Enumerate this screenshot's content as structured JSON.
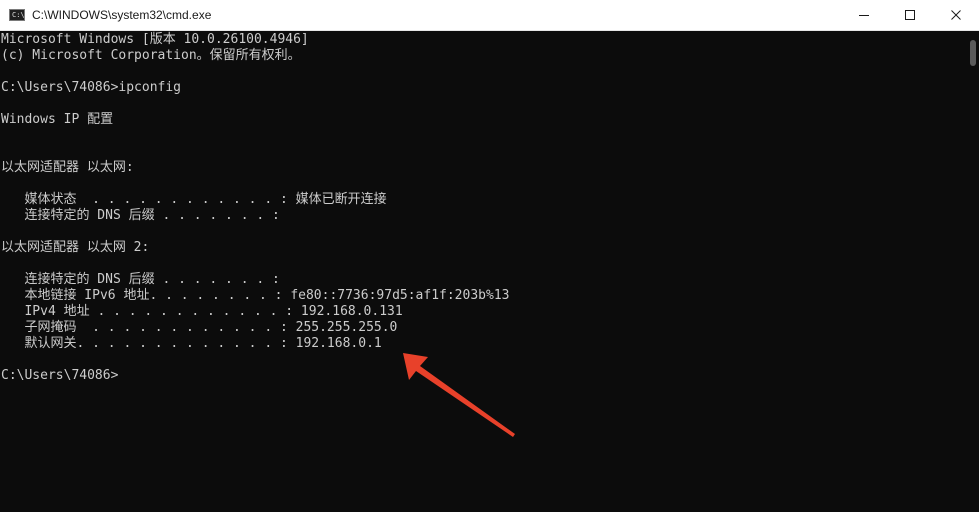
{
  "window": {
    "title": "C:\\WINDOWS\\system32\\cmd.exe",
    "icon_text": "C:\\"
  },
  "caption_buttons": {
    "minimize_icon": "minimize-icon",
    "maximize_icon": "maximize-icon",
    "close_icon": "close-icon"
  },
  "console": {
    "lines": [
      "Microsoft Windows [版本 10.0.26100.4946]",
      "(c) Microsoft Corporation。保留所有权利。",
      "",
      "C:\\Users\\74086>ipconfig",
      "",
      "Windows IP 配置",
      "",
      "",
      "以太网适配器 以太网:",
      "",
      "   媒体状态  . . . . . . . . . . . . : 媒体已断开连接",
      "   连接特定的 DNS 后缀 . . . . . . . :",
      "",
      "以太网适配器 以太网 2:",
      "",
      "   连接特定的 DNS 后缀 . . . . . . . :",
      "   本地链接 IPv6 地址. . . . . . . . : fe80::7736:97d5:af1f:203b%13",
      "   IPv4 地址 . . . . . . . . . . . . : 192.168.0.131",
      "   子网掩码  . . . . . . . . . . . . : 255.255.255.0",
      "   默认网关. . . . . . . . . . . . . : 192.168.0.1",
      "",
      "C:\\Users\\74086>"
    ]
  },
  "annotation": {
    "color": "#e8412a"
  }
}
